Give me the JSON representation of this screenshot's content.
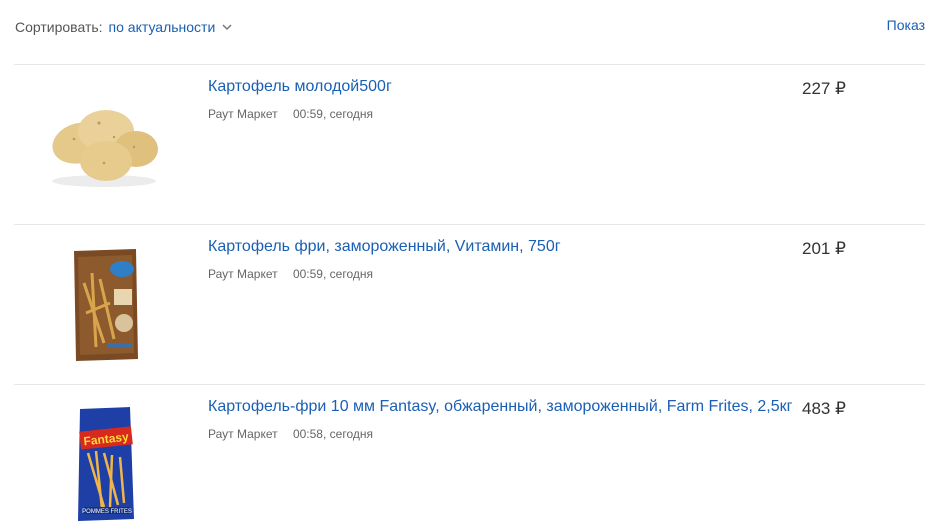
{
  "sort": {
    "label": "Сортировать:",
    "value": "по актуальности",
    "show_label": "Показ"
  },
  "items": [
    {
      "title": "Картофель молодой500г",
      "seller": "Раут Маркет",
      "time": "00:59, сегодня",
      "price": "227 ₽",
      "image": "potatoes-image"
    },
    {
      "title": "Картофель фри, замороженный, Vитамин, 750г",
      "seller": "Раут Маркет",
      "time": "00:59, сегодня",
      "price": "201 ₽",
      "image": "vitamin-fries-package-image"
    },
    {
      "title": "Картофель-фри 10 мм Fantasy, обжаренный, замороженный, Farm Frites, 2,5кг",
      "seller": "Раут Маркет",
      "time": "00:58, сегодня",
      "price": "483 ₽",
      "image": "fantasy-fries-package-image",
      "brand_text": "Fantasy",
      "brand_sub": "POMMES FRITES"
    }
  ],
  "colors": {
    "link": "#1a5fb4",
    "divider": "#e6e6e6",
    "meta": "#666666"
  }
}
